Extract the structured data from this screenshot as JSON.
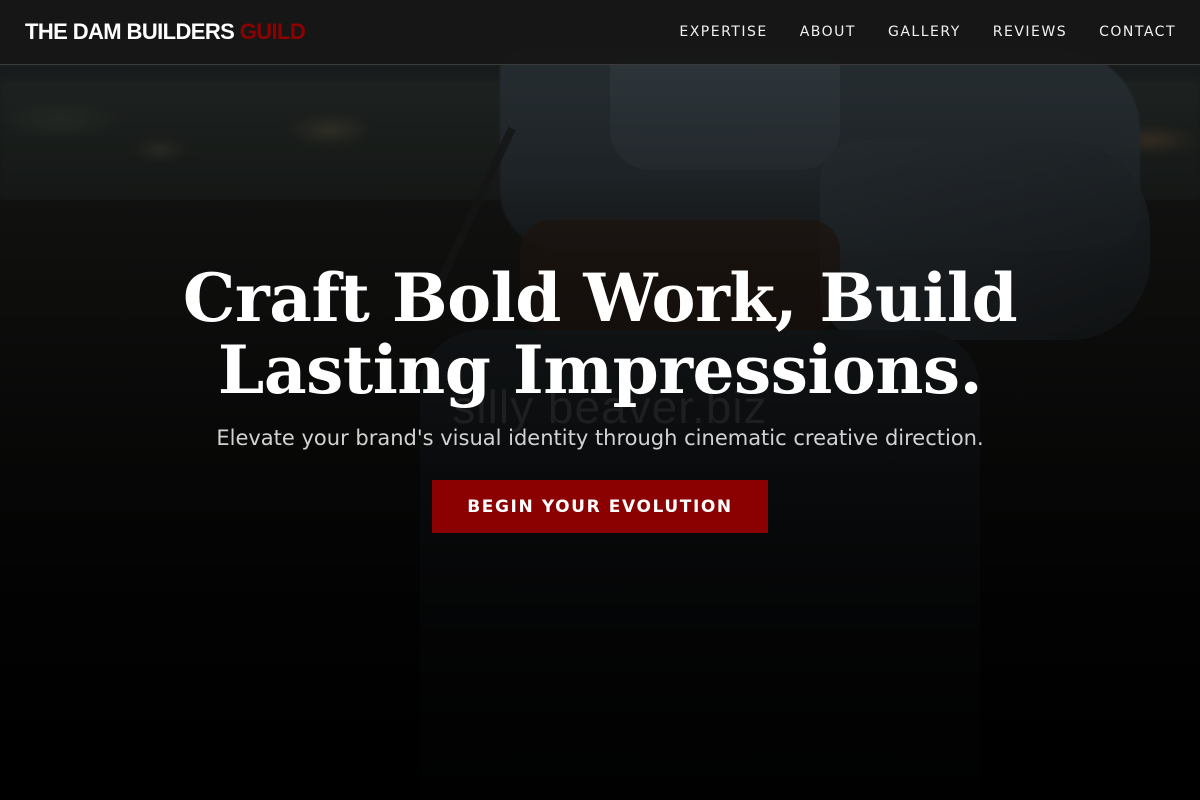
{
  "header": {
    "logo_main": "THE DAM BUILDERS",
    "logo_accent": "GUILD",
    "nav": [
      {
        "label": "EXPERTISE"
      },
      {
        "label": "ABOUT"
      },
      {
        "label": "GALLERY"
      },
      {
        "label": "REVIEWS"
      },
      {
        "label": "CONTACT"
      }
    ]
  },
  "hero": {
    "title_line1": "Craft Bold Work, Build",
    "title_line2": "Lasting Impressions.",
    "subtitle": "Elevate your brand's visual identity through cinematic creative direction.",
    "cta_label": "BEGIN YOUR EVOLUTION",
    "watermark": "silly beaver.biz"
  },
  "colors": {
    "accent": "#8b0000",
    "header_bg": "#161616",
    "text": "#ffffff",
    "subtitle_text": "#d2d2d2"
  }
}
